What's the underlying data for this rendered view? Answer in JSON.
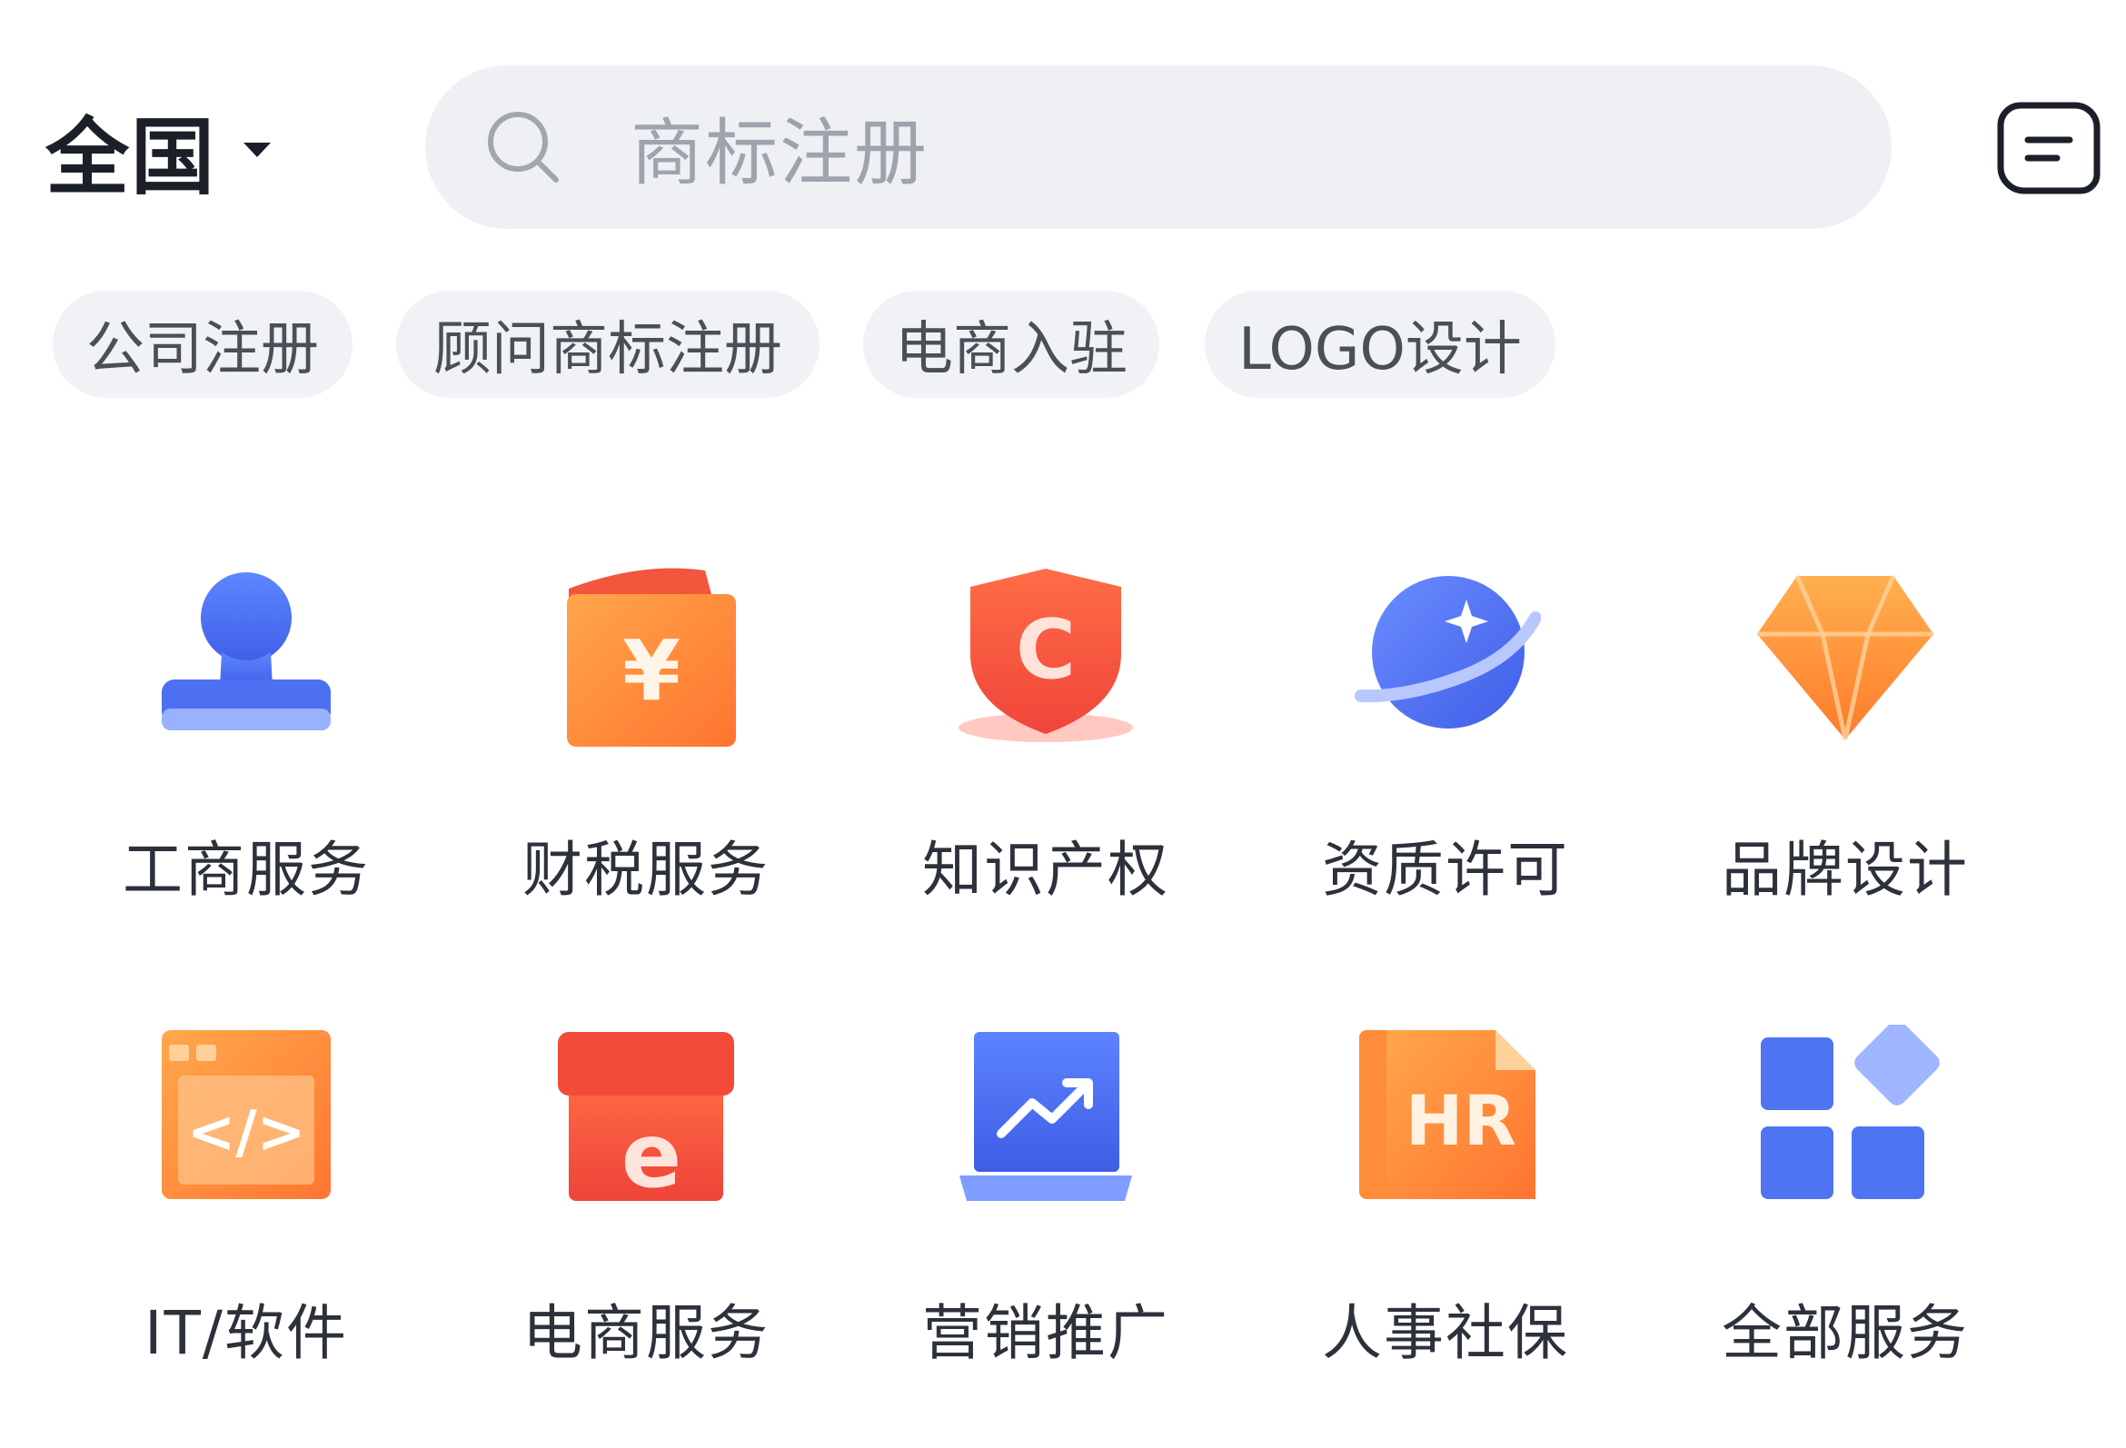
{
  "header": {
    "region": "全国",
    "search_placeholder": "商标注册"
  },
  "hot_tags": [
    "公司注册",
    "顾问商标注册",
    "电商入驻",
    "LOGO设计"
  ],
  "categories": [
    {
      "label": "工商服务",
      "icon": "person-stamp-icon"
    },
    {
      "label": "财税服务",
      "icon": "yuan-wallet-icon"
    },
    {
      "label": "知识产权",
      "icon": "copyright-shield-icon"
    },
    {
      "label": "资质许可",
      "icon": "planet-icon"
    },
    {
      "label": "品牌设计",
      "icon": "diamond-icon"
    },
    {
      "label": "IT/软件",
      "icon": "code-window-icon"
    },
    {
      "label": "电商服务",
      "icon": "ecommerce-shop-icon"
    },
    {
      "label": "营销推广",
      "icon": "trend-laptop-icon"
    },
    {
      "label": "人事社保",
      "icon": "hr-document-icon"
    },
    {
      "label": "全部服务",
      "icon": "all-services-grid-icon"
    }
  ],
  "colors": {
    "orange": "#ff8a3a",
    "red": "#f2553f",
    "blue": "#4a72f0",
    "search_bg": "#eff0f4",
    "tag_bg": "#f1f2f5"
  }
}
